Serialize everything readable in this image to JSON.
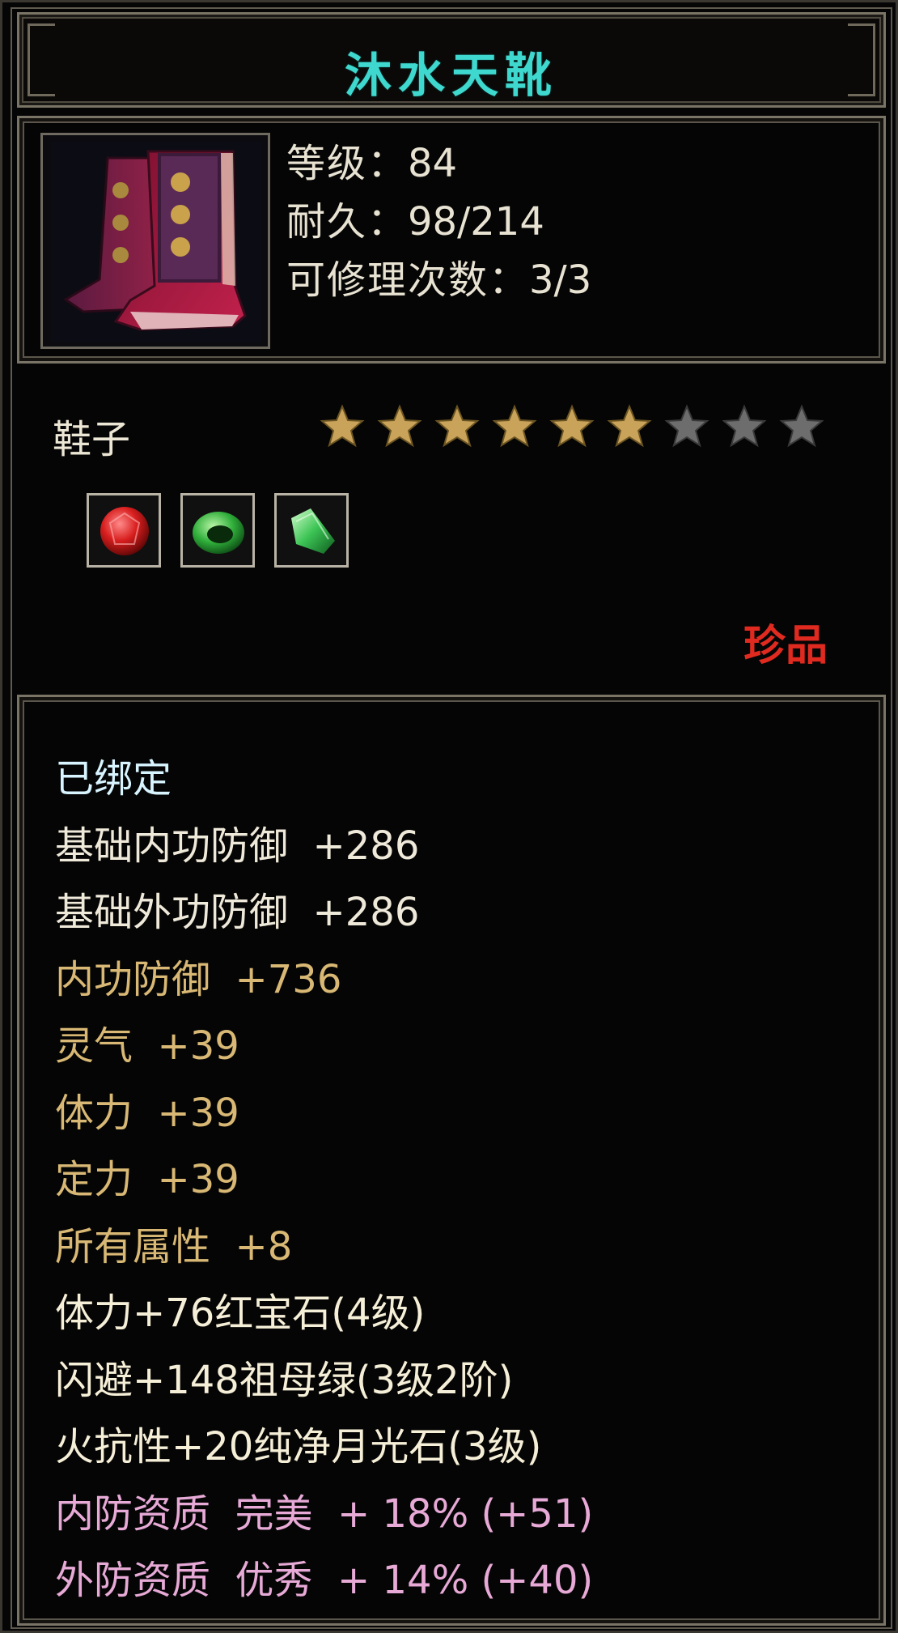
{
  "item": {
    "name": "沐水天靴",
    "stats": {
      "level_label": "等级：",
      "level_value": "84",
      "durability_label": "耐久：",
      "durability_value": "98/214",
      "repair_label": "可修理次数：",
      "repair_value": "3/3"
    },
    "type": "鞋子",
    "stars": {
      "filled": 6,
      "total": 9,
      "filled_color": "#c9a35a",
      "empty_color": "#6d6d6d"
    },
    "gems": [
      {
        "icon": "red-ruby-gem-icon",
        "color": "#d81e1e"
      },
      {
        "icon": "green-emerald-ring-gem-icon",
        "color": "#2fae3a"
      },
      {
        "icon": "green-crystal-gem-icon",
        "color": "#3cc455"
      }
    ],
    "rarity": "珍品",
    "title_color": "#3fd8cf",
    "rarity_color": "#e02a20"
  },
  "attributes": [
    {
      "text": "已绑定",
      "style": "bound"
    },
    {
      "text": "基础内功防御  +286",
      "style": "white"
    },
    {
      "text": "基础外功防御  +286",
      "style": "white"
    },
    {
      "text": "内功防御  +736",
      "style": "gold"
    },
    {
      "text": "灵气  +39",
      "style": "gold"
    },
    {
      "text": "体力  +39",
      "style": "gold"
    },
    {
      "text": "定力  +39",
      "style": "gold"
    },
    {
      "text": "所有属性  +8",
      "style": "gold"
    },
    {
      "text": "体力+76红宝石(4级)",
      "style": "gem"
    },
    {
      "text": "闪避+148祖母绿(3级2阶)",
      "style": "gem"
    },
    {
      "text": "火抗性+20纯净月光石(3级)",
      "style": "gem"
    },
    {
      "text": "内防资质  完美  + 18% (+51)",
      "style": "pink"
    },
    {
      "text": "外防资质  优秀  + 14% (+40)",
      "style": "pink"
    }
  ]
}
